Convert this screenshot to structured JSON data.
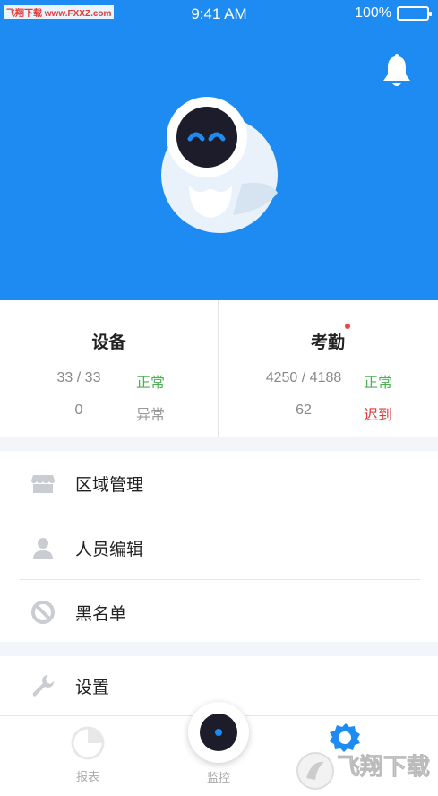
{
  "watermark_top": "飞翔下载 www.FXXZ.com",
  "status_bar": {
    "time": "9:41 AM",
    "battery": "100%"
  },
  "stats": {
    "device": {
      "title": "设备",
      "row1_value": "33 / 33",
      "row1_tag": "正常",
      "row2_value": "0",
      "row2_tag": "异常"
    },
    "attendance": {
      "title": "考勤",
      "row1_value": "4250 / 4188",
      "row1_tag": "正常",
      "row2_value": "62",
      "row2_tag": "迟到"
    }
  },
  "menu": {
    "items": [
      {
        "label": "区域管理",
        "icon": "store-icon"
      },
      {
        "label": "人员编辑",
        "icon": "person-icon"
      },
      {
        "label": "黑名单",
        "icon": "ban-icon"
      },
      {
        "label": "设置",
        "icon": "wrench-icon"
      }
    ]
  },
  "tabbar": {
    "report_label": "报表",
    "monitor_label": "监控"
  },
  "watermark_bottom": "飞翔下载",
  "colors": {
    "brand_blue": "#1e8bf2",
    "ok_green": "#4caf50",
    "late_red": "#e53935"
  }
}
